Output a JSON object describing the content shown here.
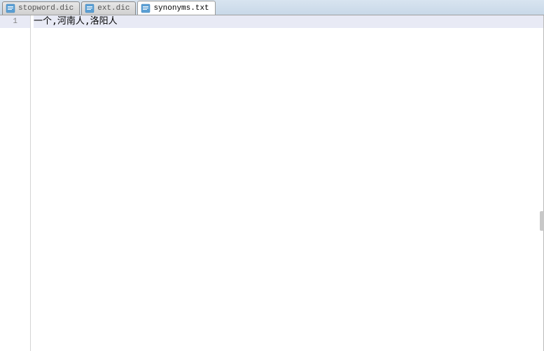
{
  "tabs": [
    {
      "label": "stopword.dic",
      "active": false
    },
    {
      "label": "ext.dic",
      "active": false
    },
    {
      "label": "synonyms.txt",
      "active": true
    }
  ],
  "editor": {
    "lines": [
      {
        "number": "1",
        "content": "一个,河南人,洛阳人",
        "current": true
      }
    ]
  }
}
